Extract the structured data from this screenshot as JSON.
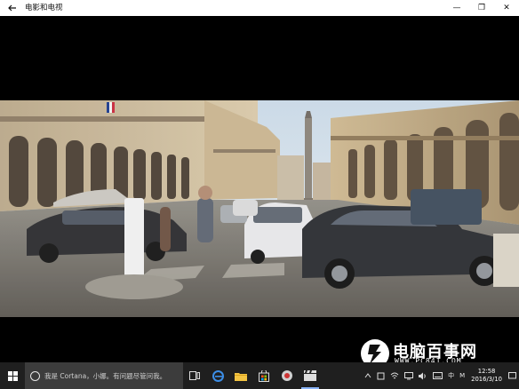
{
  "window": {
    "title": "电影和电视",
    "back_icon": "back-arrow-icon",
    "min_glyph": "—",
    "max_glyph": "❐",
    "close_glyph": "✕"
  },
  "watermark": {
    "brand": "电脑百事网",
    "url": "WWW.PC841.COM"
  },
  "taskbar": {
    "search_placeholder": "我是 Cortana，小娜。有问题尽管问我。",
    "tray": {
      "ime_label": "中",
      "ime_mode": "M",
      "time": "12:58",
      "date": "2016/3/10"
    }
  },
  "colors": {
    "taskbar_bg": "#1f1f1f",
    "search_bg": "#3c3c3c",
    "accent": "#8ab4f8"
  }
}
